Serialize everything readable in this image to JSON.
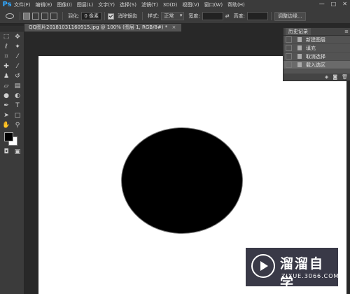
{
  "app": {
    "logo": "Ps"
  },
  "menubar": {
    "items": [
      "文件(F)",
      "编辑(E)",
      "图像(I)",
      "图层(L)",
      "文字(Y)",
      "选择(S)",
      "滤镜(T)",
      "3D(D)",
      "视图(V)",
      "窗口(W)",
      "帮助(H)"
    ],
    "window_controls": [
      "—",
      "□",
      "✕"
    ]
  },
  "options": {
    "feather_label": "羽化:",
    "feather_value": "0 像素",
    "antialias_label": "消除锯齿",
    "antialias_checked": true,
    "style_label": "样式:",
    "style_value": "正常",
    "width_label": "宽度:",
    "height_label": "高度:",
    "refine_edge_button": "调整边缘..."
  },
  "document": {
    "tab_title": "QQ图片20181031160915.jpg @ 100% (图层 1, RGB/8#) *",
    "close_glyph": "×",
    "canvas_color": "#ffffff",
    "shape_color": "#000000"
  },
  "history": {
    "tab_label": "历史记录",
    "menu_glyph": "≡",
    "items": [
      {
        "label": "新建图层",
        "selected": false
      },
      {
        "label": "填充",
        "selected": false
      },
      {
        "label": "取消选择",
        "selected": false
      },
      {
        "label": "载入选区",
        "selected": true
      }
    ],
    "footer_icons": [
      "snapshot-icon",
      "camera-icon",
      "trash-icon"
    ],
    "footer_glyphs": [
      "◈",
      "◙",
      "🗑"
    ]
  },
  "toolbar": {
    "tools": [
      "rectangular-marquee-icon",
      "move-icon",
      "lasso-icon",
      "magic-wand-icon",
      "crop-icon",
      "eyedropper-icon",
      "spot-healing-icon",
      "brush-icon",
      "clone-stamp-icon",
      "history-brush-icon",
      "eraser-icon",
      "gradient-icon",
      "blur-icon",
      "dodge-icon",
      "pen-icon",
      "type-icon",
      "path-select-icon",
      "rectangle-shape-icon",
      "hand-icon",
      "zoom-icon"
    ],
    "foreground_color": "#000000",
    "background_color": "#ffffff"
  },
  "watermark": {
    "title": "溜溜自学",
    "url": "ZIXUE.3066.COM"
  }
}
